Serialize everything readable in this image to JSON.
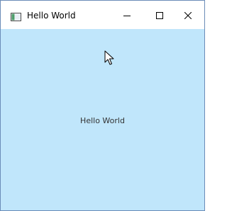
{
  "window": {
    "title": "Hello World",
    "icon": "app-window-icon"
  },
  "caption_buttons": {
    "minimize_icon": "minimize-icon",
    "maximize_icon": "maximize-icon",
    "close_icon": "close-icon"
  },
  "content": {
    "text": "Hello World",
    "background_color": "#c0e6fb"
  },
  "cursor": {
    "icon": "mouse-pointer-icon"
  }
}
